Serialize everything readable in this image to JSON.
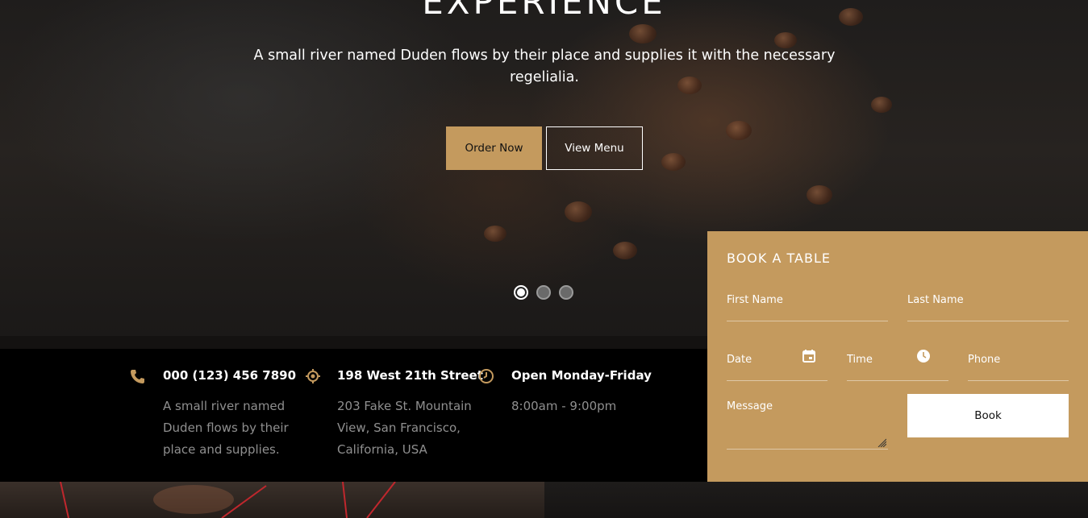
{
  "hero": {
    "title": "EXPERIENCE",
    "subtitle": "A small river named Duden flows by their place and supplies it with the necessary regelialia.",
    "order_label": "Order Now",
    "menu_label": "View Menu",
    "slides_total": 3,
    "slide_active": 1
  },
  "info": [
    {
      "icon": "phone-icon",
      "title": "000 (123) 456 7890",
      "lines": [
        "A small river named",
        "Duden flows by their",
        "place and supplies."
      ]
    },
    {
      "icon": "location-icon",
      "title": "198 West 21th Street",
      "lines": [
        "203 Fake St. Mountain",
        "View, San Francisco,",
        "California, USA"
      ]
    },
    {
      "icon": "clock-icon",
      "title": "Open Monday-Friday",
      "lines": [
        "8:00am - 9:00pm"
      ]
    }
  ],
  "book": {
    "title": "BOOK A TABLE",
    "first_name_placeholder": "First Name",
    "last_name_placeholder": "Last Name",
    "date_placeholder": "Date",
    "time_placeholder": "Time",
    "phone_placeholder": "Phone",
    "message_placeholder": "Message",
    "submit_label": "Book"
  },
  "colors": {
    "accent": "#c49a5e",
    "info_bar_bg": "#000000",
    "muted_text": "#8f8f8f"
  }
}
